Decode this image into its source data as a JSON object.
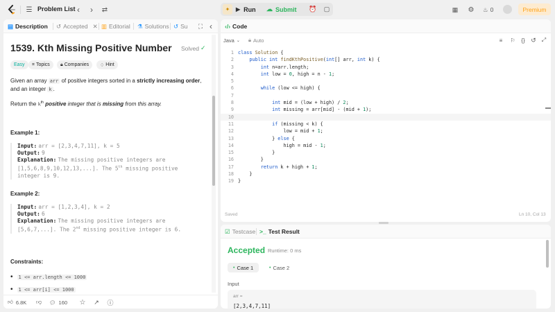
{
  "topbar": {
    "problem_list": "Problem List",
    "run": "Run",
    "submit": "Submit",
    "streak": "0",
    "premium": "Premium"
  },
  "left": {
    "tabs": {
      "description": "Description",
      "accepted": "Accepted",
      "editorial": "Editorial",
      "solutions": "Solutions",
      "submissions": "Su"
    },
    "title": "1539. Kth Missing Positive Number",
    "status": "Solved",
    "tags": {
      "difficulty": "Easy",
      "topics": "Topics",
      "companies": "Companies",
      "hint": "Hint"
    },
    "desc1_a": "Given an array ",
    "desc1_code": "arr",
    "desc1_b": " of positive integers sorted in a ",
    "desc1_bold": "strictly increasing order",
    "desc1_c": ",",
    "desc1_d": "and an integer ",
    "desc1_code2": "k",
    "desc2_a": "Return the ",
    "desc2_k": "k",
    "desc2_sup": "th",
    "desc2_b": "positive",
    "desc2_c": " integer that is ",
    "desc2_d": "missing",
    "desc2_e": " from this array.",
    "ex1": {
      "heading": "Example 1:",
      "input_label": "Input:",
      "input": "arr = [2,3,4,7,11], k = 5",
      "output_label": "Output:",
      "output": "9",
      "expl_label": "Explanation:",
      "expl1": "The missing positive integers are",
      "expl2a": "[1,5,6,8,9,10,12,13,...]. The 5",
      "expl2sup": "th",
      "expl2b": " missing positive",
      "expl3": "integer is 9."
    },
    "ex2": {
      "heading": "Example 2:",
      "input_label": "Input:",
      "input": "arr = [1,2,3,4], k = 2",
      "output_label": "Output:",
      "output": "6",
      "expl_label": "Explanation:",
      "expl1": "The missing positive integers are",
      "expl2a": "[5,6,7,...]. The 2",
      "expl2sup": "nd",
      "expl2b": " missing positive integer is 6."
    },
    "constraints": {
      "heading": "Constraints:",
      "c1": "1 <= arr.length <= 1000",
      "c2": "1 <= arr[i] <= 1000"
    },
    "footer": {
      "likes": "6.8K",
      "comments": "160"
    }
  },
  "code": {
    "header": "Code",
    "language": "Java",
    "mode": "Auto",
    "saved": "Saved",
    "cursor": "Ln 10, Col 13",
    "lines": [
      "class Solution {",
      "    public int findKthPositive(int[] arr, int k) {",
      "        int n=arr.length;",
      "        int low = 0, high = n - 1;",
      "",
      "        while (low <= high) {",
      "",
      "            int mid = (low + high) / 2;",
      "            int missing = arr[mid] - (mid + 1);",
      "",
      "            if (missing < k) {",
      "                low = mid + 1;",
      "            } else {",
      "                high = mid - 1;",
      "            }",
      "        }",
      "        return k + high + 1;",
      "    }",
      "}"
    ]
  },
  "test": {
    "tab_testcase": "Testcase",
    "tab_result": "Test Result",
    "accepted": "Accepted",
    "runtime": "Runtime: 0 ms",
    "case1": "Case 1",
    "case2": "Case 2",
    "input_label": "Input",
    "var_label": "arr =",
    "var_value": "[2,3,4,7,11]"
  },
  "colors": {
    "accepted": "#2db55d",
    "submit": "#2db55d",
    "premium": "#ffa116"
  }
}
